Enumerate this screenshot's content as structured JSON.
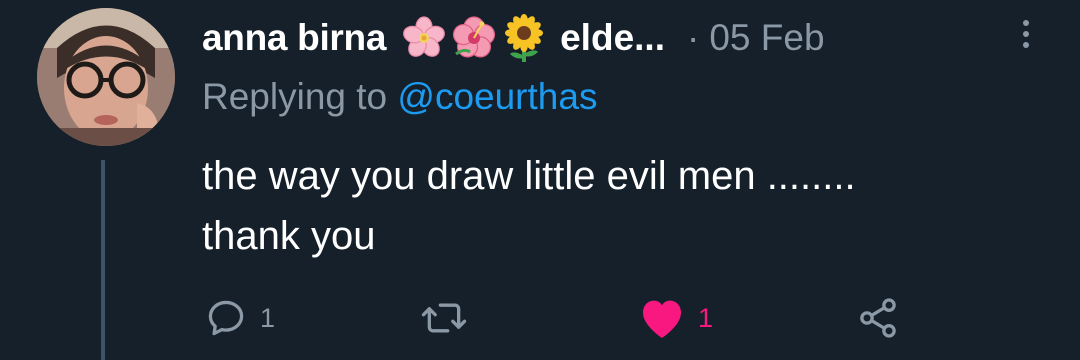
{
  "tweet": {
    "display_name": "anna birna",
    "name_emojis": [
      "cherry-blossom",
      "hibiscus",
      "sunflower"
    ],
    "name_continuation": "elde...",
    "separator": "·",
    "date": "05 Feb",
    "replying_prefix": "Replying to ",
    "replying_handle": "@coeurthas",
    "body_line1": "the way you draw little evil men ........",
    "body_line2": "thank you",
    "actions": {
      "reply_count": "1",
      "retweet_count": "",
      "like_count": "1",
      "liked": true
    }
  },
  "colors": {
    "background": "#15202b",
    "text": "#ffffff",
    "muted": "#8b98a5",
    "link": "#1d9bf0",
    "like": "#f91880",
    "thread_line": "#3d5466"
  }
}
